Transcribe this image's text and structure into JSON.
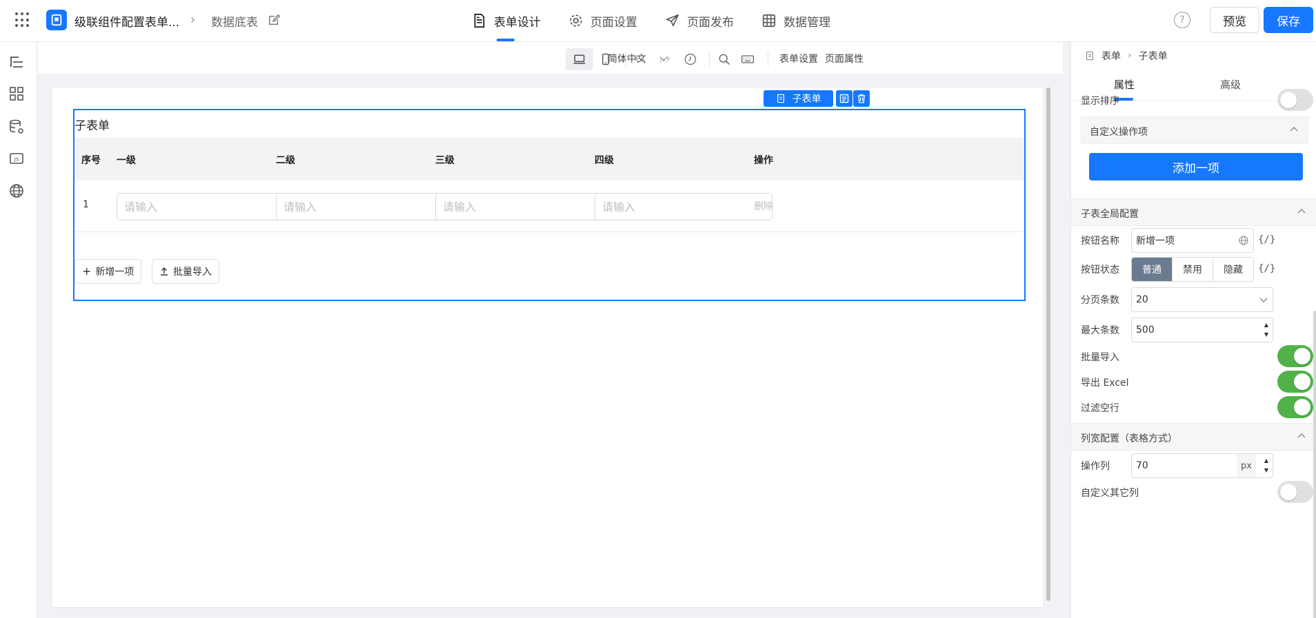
{
  "topbar": {
    "app_title": "级联组件配置表单...",
    "crumb_sub": "数据底表",
    "tabs": [
      {
        "label": "表单设计",
        "icon": "document-icon",
        "active": true
      },
      {
        "label": "页面设置",
        "icon": "gear-icon",
        "active": false
      },
      {
        "label": "页面发布",
        "icon": "send-icon",
        "active": false
      },
      {
        "label": "数据管理",
        "icon": "table-grid-icon",
        "active": false
      }
    ],
    "help_glyph": "?",
    "preview_label": "预览",
    "save_label": "保存"
  },
  "toolbar": {
    "language": "简体中文",
    "form_settings": "表单设置",
    "page_props": "页面属性"
  },
  "canvas": {
    "badge_label": "子表单",
    "subform_title": "子表单",
    "columns": [
      "序号",
      "一级",
      "二级",
      "三级",
      "四级",
      "操作"
    ],
    "row_index": "1",
    "input_placeholder": "请输入",
    "delete_label": "删除",
    "add_row_label": "新增一项",
    "bulk_import_label": "批量导入"
  },
  "panel": {
    "crumb_root": "表单",
    "crumb_current": "子表单",
    "tab_props": "属性",
    "tab_advanced": "高级",
    "show_sort_label": "显示排序",
    "show_sort_on": false,
    "custom_ops_label": "自定义操作项",
    "add_item_label": "添加一项",
    "global_section": "子表全局配置",
    "btn_name_label": "按钮名称",
    "btn_name_value": "新增一项",
    "expr_label": "{/}",
    "btn_state_label": "按钮状态",
    "btn_states": [
      "普通",
      "禁用",
      "隐藏"
    ],
    "btn_state_active": "普通",
    "page_size_label": "分页条数",
    "page_size_value": "20",
    "max_rows_label": "最大条数",
    "max_rows_value": "500",
    "bulk_import_label": "批量导入",
    "bulk_import_on": true,
    "export_excel_label": "导出 Excel",
    "export_excel_on": true,
    "filter_empty_label": "过滤空行",
    "filter_empty_on": true,
    "col_width_section": "列宽配置（表格方式）",
    "op_col_label": "操作列",
    "op_col_value": "70",
    "op_col_unit": "px",
    "custom_cols_label": "自定义其它列",
    "custom_cols_on": false
  },
  "colors": {
    "primary": "#1677ff",
    "toggle_on": "#52b24a",
    "segment_active": "#6b7b8f"
  }
}
